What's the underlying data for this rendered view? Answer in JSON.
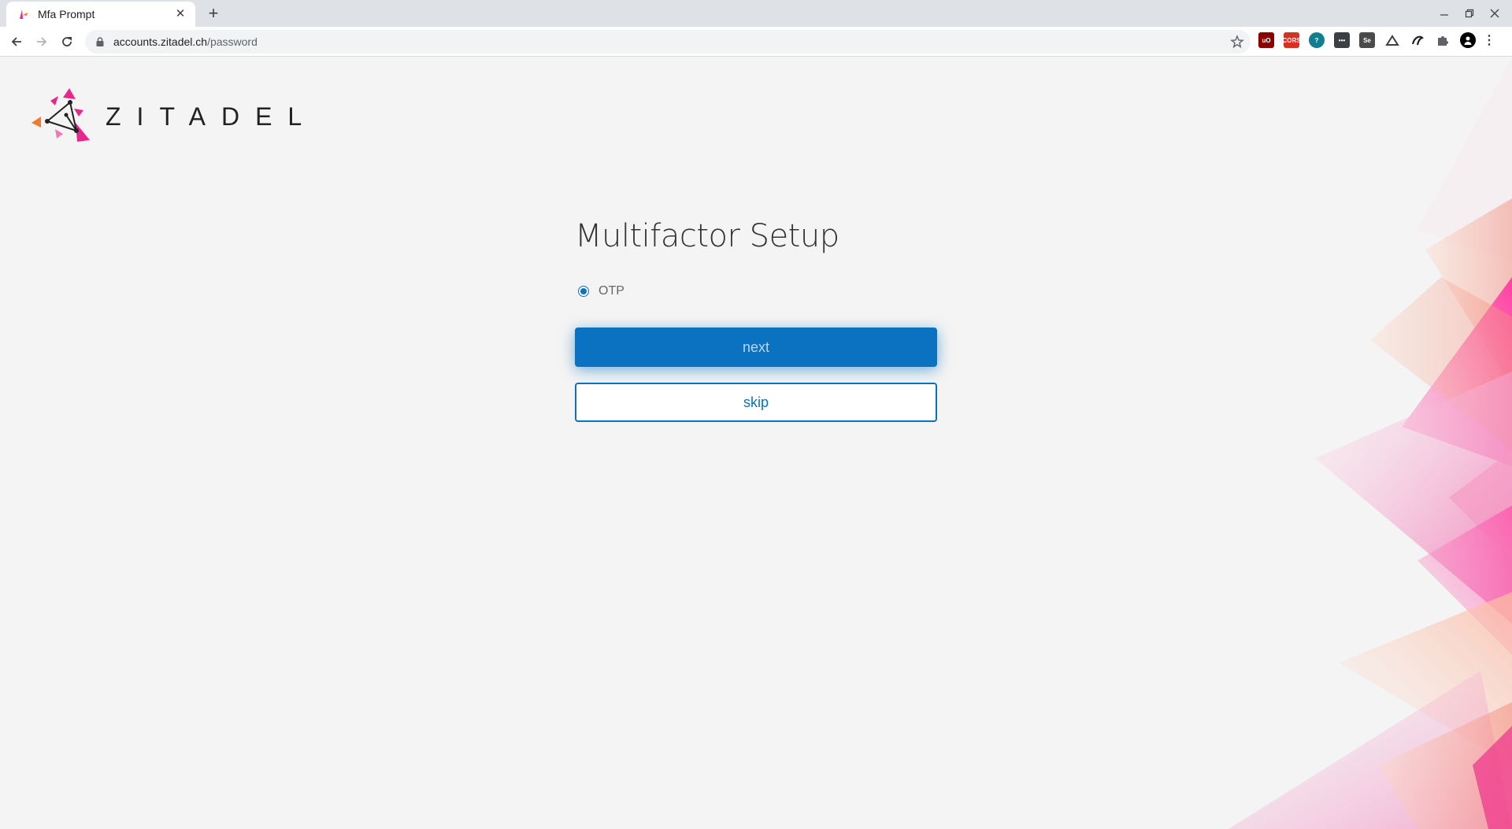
{
  "browser": {
    "tab_title": "Mfa Prompt",
    "tab_close": "✕",
    "new_tab": "+",
    "url_host": "accounts.zitadel.ch",
    "url_path": "/password",
    "extensions": [
      "ublock-icon",
      "cors-icon",
      "question-icon",
      "dots-icon",
      "selenium-icon",
      "ninja-icon",
      "gnu-icon",
      "puzzle-icon",
      "profile-icon"
    ]
  },
  "logo": {
    "text": "ZITADEL"
  },
  "main": {
    "title": "Multifactor Setup",
    "options": [
      {
        "label": "OTP",
        "selected": true
      }
    ],
    "next_label": "next",
    "skip_label": "skip"
  },
  "colors": {
    "accent": "#0a72c0",
    "background": "#f4f4f4",
    "logo_pink": "#e6288c",
    "logo_orange": "#f47a2c"
  }
}
